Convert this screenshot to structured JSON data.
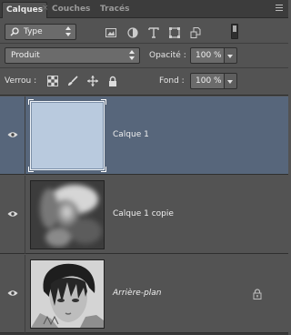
{
  "tabs": [
    {
      "label": "Calques",
      "active": true
    },
    {
      "label": "Couches",
      "active": false
    },
    {
      "label": "Tracés",
      "active": false
    }
  ],
  "filter": {
    "type_label": "Type",
    "icons": [
      "image-filter-icon",
      "adjustment-filter-icon",
      "text-filter-icon",
      "shape-filter-icon",
      "smart-object-filter-icon",
      "filter-toggle-icon"
    ]
  },
  "blend": {
    "mode": "Produit",
    "opacity_label": "Opacité :",
    "opacity_value": "100 %"
  },
  "lock": {
    "label": "Verrou :",
    "icons": [
      "lock-transparency-icon",
      "lock-pixels-icon",
      "lock-position-icon",
      "lock-all-icon"
    ],
    "fill_label": "Fond :",
    "fill_value": "100 %"
  },
  "layers": [
    {
      "name": "Calque 1",
      "selected": true,
      "italic": false,
      "locked": false
    },
    {
      "name": "Calque 1 copie",
      "selected": false,
      "italic": false,
      "locked": false
    },
    {
      "name": "Arrière-plan",
      "selected": false,
      "italic": true,
      "locked": true
    }
  ],
  "colors": {
    "panel_bg": "#535353",
    "selected_row": "#57667b",
    "layer1_fill": "#b9cade"
  }
}
